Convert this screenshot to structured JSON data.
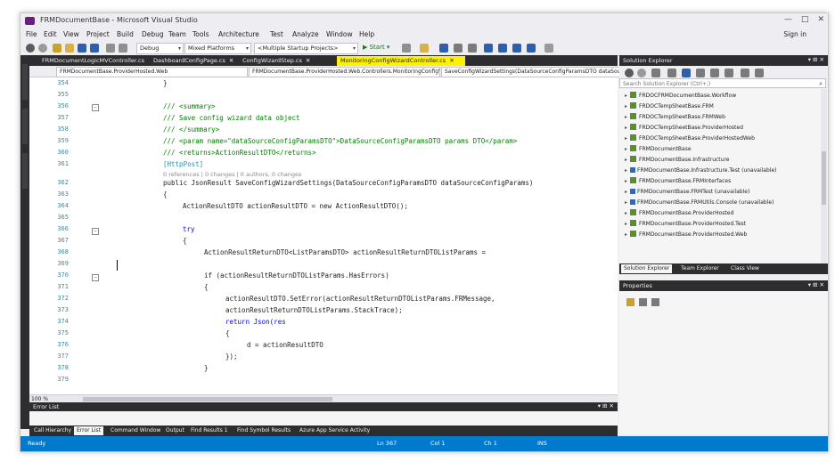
{
  "window": {
    "title": "FRMDocumentBase - Microsoft Visual Studio",
    "controls": [
      "—",
      "□",
      "✕"
    ],
    "sign_in": "Sign in"
  },
  "menu": [
    "File",
    "Edit",
    "View",
    "Project",
    "Build",
    "Debug",
    "Team",
    "Tools",
    "Architecture",
    "Test",
    "Analyze",
    "Window",
    "Help"
  ],
  "toolbar": {
    "config": "Debug",
    "platform": "Mixed Platforms",
    "startup": "<Multiple Startup Projects>",
    "start_label": "▶ Start ▾"
  },
  "doc_tabs": [
    {
      "label": "FRMDocumentLogicMVController.cs",
      "active": false
    },
    {
      "label": "DashboardConfigPage.cs",
      "active": false
    },
    {
      "label": "ConfigWizardStep.cs",
      "active": false
    },
    {
      "label": "MonitoringConfigWizardController.cs",
      "active": true
    }
  ],
  "nav": {
    "project": "FRMDocumentBase.ProviderHosted.Web",
    "class": "FRMDocumentBase.ProviderHosted.Web.Controllers.MonitoringConfigWizardController",
    "member": "SaveConfigWizardSettings(DataSourceConfigParamsDTO dataSourceConfigParams)"
  },
  "code": {
    "lines": [
      {
        "num": "354",
        "text": "}"
      },
      {
        "num": "355",
        "text": ""
      },
      {
        "num": "356",
        "text": "/// <summary>"
      },
      {
        "num": "357",
        "text": "/// Save config wizard data object"
      },
      {
        "num": "358",
        "text": "/// </summary>"
      },
      {
        "num": "359",
        "text": "/// <param name=\"dataSourceConfigParamsDTO\">DataSourceConfigParamsDTO params DTO</param>"
      },
      {
        "num": "360",
        "text": "/// <returns>ActionResultDTO</returns>"
      },
      {
        "num": "361",
        "text": "[HttpPost]"
      },
      {
        "num": "362",
        "text": "public JsonResult SaveConfigWizardSettings(DataSourceConfigParamsDTO dataSourceConfigParams)"
      },
      {
        "num": "363",
        "text": "{"
      },
      {
        "num": "364",
        "text": "ActionResultDTO actionResultDTO = new ActionResultDTO();"
      },
      {
        "num": "365",
        "text": ""
      },
      {
        "num": "366",
        "text": "try"
      },
      {
        "num": "367",
        "text": "{"
      },
      {
        "num": "368",
        "text": "ActionResultReturnDTO<ListParamsDTO> actionResultReturnDTOListParams ="
      },
      {
        "num": "369",
        "text": ""
      },
      {
        "num": "370",
        "text": "if (actionResultReturnDTOListParams.HasErrors)"
      },
      {
        "num": "371",
        "text": "{"
      },
      {
        "num": "372",
        "text": "actionResultDTO.SetError(actionResultReturnDTOListParams.FRMessage,"
      },
      {
        "num": "373",
        "text": "actionResultReturnDTOListParams.StackTrace);"
      },
      {
        "num": "374",
        "text": "return Json(res"
      },
      {
        "num": "375",
        "text": "{"
      },
      {
        "num": "376",
        "text": "d = actionResultDTO"
      },
      {
        "num": "377",
        "text": "});"
      },
      {
        "num": "378",
        "text": "}"
      },
      {
        "num": "379",
        "text": ""
      }
    ],
    "hint": "0 references | 0 changes | 0 authors, 0 changes"
  },
  "editor": {
    "zoom": "100 %"
  },
  "error_list": {
    "title": "Error List",
    "controls": "▾ ⊞ ✕"
  },
  "bottom_tabs": [
    {
      "label": "Call Hierarchy",
      "active": false
    },
    {
      "label": "Error List",
      "active": true
    },
    {
      "label": "Command Window",
      "active": false
    },
    {
      "label": "Output",
      "active": false
    },
    {
      "label": "Find Results 1",
      "active": false
    },
    {
      "label": "Find Symbol Results",
      "active": false
    },
    {
      "label": "Azure App Service Activity",
      "active": false
    }
  ],
  "solution_explorer": {
    "title": "Solution Explorer",
    "controls": "▾ ⊞ ✕",
    "search_placeholder": "Search Solution Explorer (Ctrl+;)",
    "items": [
      "FRDOCFRMDocumentBase.Workflow",
      "FRDOCTempSheetBase.FRM",
      "FRDOCTempSheetBase.FRMWeb",
      "FRDOCTempSheetBase.ProviderHosted",
      "FRDOCTempSheetBase.ProviderHostedWeb",
      "FRMDocumentBase",
      "FRMDocumentBase.Infrastructure",
      "FRMDocumentBase.Infrastructure.Test (unavailable)",
      "FRMDocumentBase.FRMInterfaces",
      "FRMDocumentBase.FRMTest (unavailable)",
      "FRMDocumentBase.FRMUtils.Console (unavailable)",
      "FRMDocumentBase.ProviderHosted",
      "FRMDocumentBase.ProviderHosted.Test",
      "FRMDocumentBase.ProviderHosted.Web"
    ],
    "tabs": [
      {
        "label": "Solution Explorer",
        "active": true
      },
      {
        "label": "Team Explorer",
        "active": false
      },
      {
        "label": "Class View",
        "active": false
      }
    ]
  },
  "properties": {
    "title": "Properties",
    "controls": "▾ ⊞ ✕"
  },
  "status": {
    "ready": "Ready",
    "ln": "Ln 367",
    "col": "Col 1",
    "ch": "Ch 1",
    "ins": "INS"
  },
  "colors": {
    "status_bar": "#007acc",
    "dark_chrome": "#2d2d30",
    "active_tab": "#fff200",
    "comment": "#008000",
    "keyword": "#0000ff",
    "type": "#2b91af"
  }
}
